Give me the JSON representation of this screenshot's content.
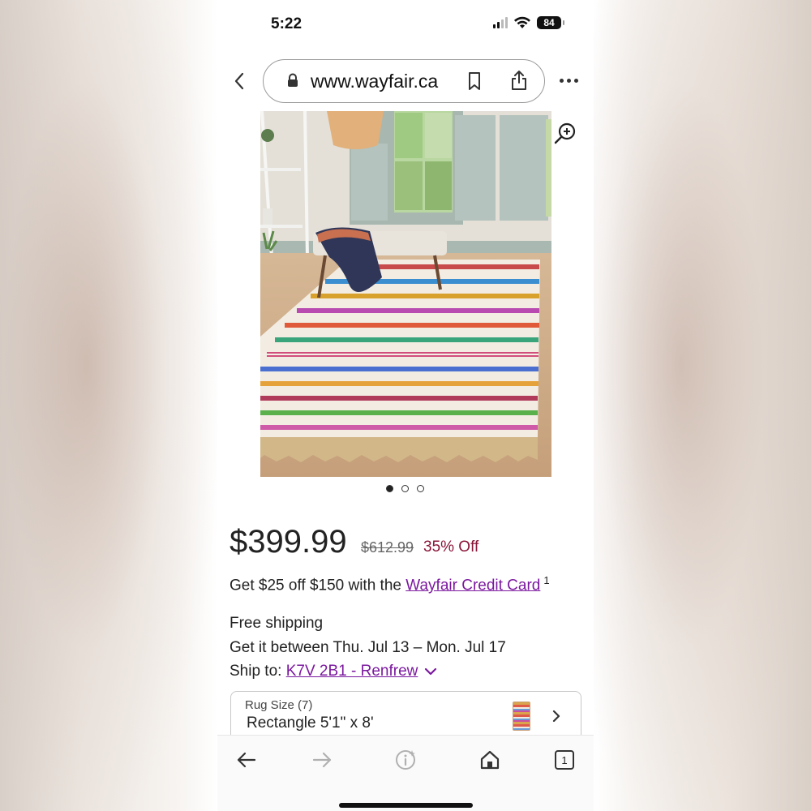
{
  "status_bar": {
    "time": "5:22",
    "battery": "84"
  },
  "browser": {
    "url": "www.wayfair.ca",
    "tab_count": "1"
  },
  "gallery": {
    "image_count": 3,
    "active_index": 0
  },
  "product": {
    "price": "$399.99",
    "original_price": "$612.99",
    "discount": "35% Off",
    "credit_text": "Get $25 off $150 with the",
    "credit_link": "Wayfair Credit Card",
    "credit_footnote": "1"
  },
  "shipping": {
    "free": "Free shipping",
    "dates": "Get it between Thu. Jul 13 – Mon. Jul 17",
    "ship_to_label": "Ship to:",
    "ship_to_value": "K7V 2B1 - Renfrew"
  },
  "option": {
    "label": "Rug Size (7)",
    "value": "Rectangle 5'1\" x 8'"
  },
  "colors": {
    "link": "#7b189f",
    "discount": "#8a1538"
  }
}
